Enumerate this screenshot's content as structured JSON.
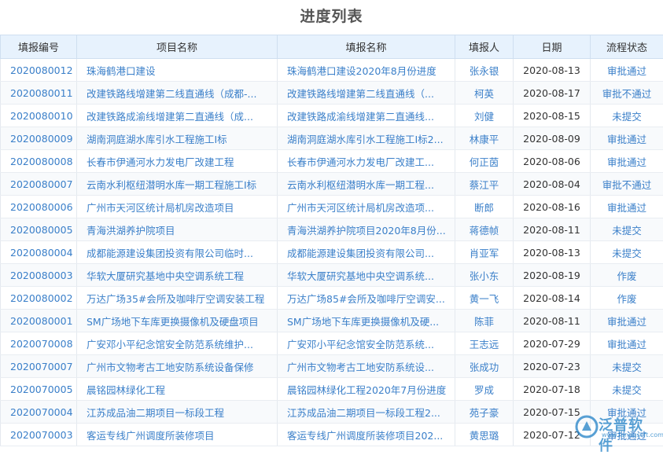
{
  "page": {
    "title": "进度列表"
  },
  "table": {
    "columns": [
      "填报编号",
      "项目名称",
      "填报名称",
      "填报人",
      "日期",
      "流程状态"
    ],
    "rows": [
      {
        "id": "2020080012",
        "project": "珠海鹤港口建设",
        "report": "珠海鹤港口建设2020年8月份进度",
        "reporter": "张永银",
        "date": "2020-08-13",
        "status": "审批通过",
        "status_type": "approved"
      },
      {
        "id": "2020080011",
        "project": "改建铁路线增建第二线直通线（成都-...",
        "report": "改建铁路线增建第二线直通线（...",
        "reporter": "柯英",
        "date": "2020-08-17",
        "status": "审批不通过",
        "status_type": "rejected"
      },
      {
        "id": "2020080010",
        "project": "改建铁路成渝线增建第二直通线（成...",
        "report": "改建铁路成渝线增建第二直通线...",
        "reporter": "刘健",
        "date": "2020-08-15",
        "status": "未提交",
        "status_type": "unsubmitted"
      },
      {
        "id": "2020080009",
        "project": "湖南洞庭湖水库引水工程施工I标",
        "report": "湖南洞庭湖水库引水工程施工I标2...",
        "reporter": "林康平",
        "date": "2020-08-09",
        "status": "审批通过",
        "status_type": "approved"
      },
      {
        "id": "2020080008",
        "project": "长春市伊通河水力发电厂改建工程",
        "report": "长春市伊通河水力发电厂改建工...",
        "reporter": "何正茵",
        "date": "2020-08-06",
        "status": "审批通过",
        "status_type": "approved"
      },
      {
        "id": "2020080007",
        "project": "云南水利枢纽潜明水库一期工程施工I标",
        "report": "云南水利枢纽潜明水库一期工程...",
        "reporter": "蔡江平",
        "date": "2020-08-04",
        "status": "审批不通过",
        "status_type": "rejected"
      },
      {
        "id": "2020080006",
        "project": "广州市天河区统计局机房改造项目",
        "report": "广州市天河区统计局机房改造项...",
        "reporter": "断郎",
        "date": "2020-08-16",
        "status": "审批通过",
        "status_type": "approved"
      },
      {
        "id": "2020080005",
        "project": "青海洪湖养护院项目",
        "report": "青海洪湖养护院项目2020年8月份...",
        "reporter": "蒋德帧",
        "date": "2020-08-11",
        "status": "未提交",
        "status_type": "unsubmitted"
      },
      {
        "id": "2020080004",
        "project": "成都能源建设集团投资有限公司临时...",
        "report": "成都能源建设集团投资有限公司...",
        "reporter": "肖亚军",
        "date": "2020-08-13",
        "status": "未提交",
        "status_type": "unsubmitted"
      },
      {
        "id": "2020080003",
        "project": "华软大厦研究基地中央空调系统工程",
        "report": "华软大厦研究基地中央空调系统...",
        "reporter": "张小东",
        "date": "2020-08-19",
        "status": "作废",
        "status_type": "void"
      },
      {
        "id": "2020080002",
        "project": "万达广场35#会所及咖啡厅空调安装工程",
        "report": "万达广场85#会所及咖啡厅空调安...",
        "reporter": "黄一飞",
        "date": "2020-08-14",
        "status": "作废",
        "status_type": "void"
      },
      {
        "id": "2020080001",
        "project": "SM广场地下车库更换摄像机及硬盘项目",
        "report": "SM广场地下车库更换摄像机及硬...",
        "reporter": "陈菲",
        "date": "2020-08-11",
        "status": "审批通过",
        "status_type": "approved"
      },
      {
        "id": "2020070008",
        "project": "广安邓小平纪念馆安全防范系统维护...",
        "report": "广安邓小平纪念馆安全防范系统...",
        "reporter": "王志远",
        "date": "2020-07-29",
        "status": "审批通过",
        "status_type": "approved"
      },
      {
        "id": "2020070007",
        "project": "广州市文物考古工地安防系统设备保修",
        "report": "广州市文物考古工地安防系统设...",
        "reporter": "张成功",
        "date": "2020-07-23",
        "status": "未提交",
        "status_type": "unsubmitted"
      },
      {
        "id": "2020070005",
        "project": "晨铭园林绿化工程",
        "report": "晨铭园林绿化工程2020年7月份进度",
        "reporter": "罗成",
        "date": "2020-07-18",
        "status": "未提交",
        "status_type": "unsubmitted"
      },
      {
        "id": "2020070004",
        "project": "江苏成品油二期项目一标段工程",
        "report": "江苏成品油二期项目一标段工程2...",
        "reporter": "苑子豪",
        "date": "2020-07-15",
        "status": "审批通过",
        "status_type": "approved"
      },
      {
        "id": "2020070003",
        "project": "客运专线广州调度所装修项目",
        "report": "客运专线广州调度所装修项目202...",
        "reporter": "黄思璐",
        "date": "2020-07-12",
        "status": "审批通过",
        "status_type": "approved"
      }
    ]
  },
  "watermark": {
    "name": "泛普软件",
    "url": "www.fanpusoft.com"
  },
  "colors": {
    "header_bg": "#e7f2fd",
    "link": "#3a7fc9",
    "approved": "#2e8b2e",
    "rejected": "#d42020",
    "unsubmitted": "#2d2ddc",
    "void": "#8a3b8a"
  }
}
